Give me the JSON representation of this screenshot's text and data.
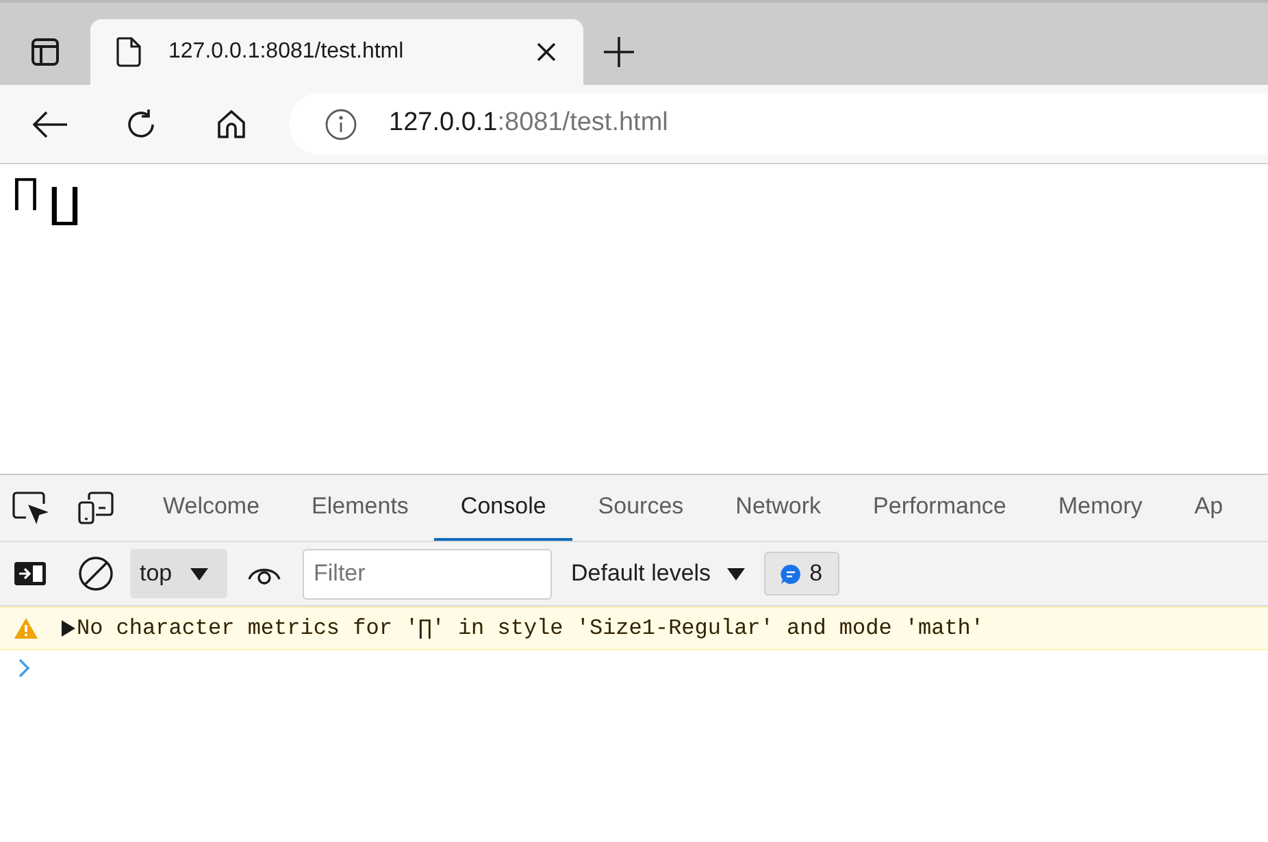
{
  "browser": {
    "tabs": [
      {
        "title": "127.0.0.1:8081/test.html",
        "selected": true
      }
    ],
    "address_bar": {
      "host": "127.0.0.1",
      "path": ":8081/test.html"
    }
  },
  "page": {
    "glyphs": [
      {
        "char": "∏",
        "kind": "inline"
      },
      {
        "char": "∐",
        "kind": "large"
      }
    ]
  },
  "devtools": {
    "tabs": [
      {
        "label": "Welcome",
        "selected": false
      },
      {
        "label": "Elements",
        "selected": false
      },
      {
        "label": "Console",
        "selected": true
      },
      {
        "label": "Sources",
        "selected": false
      },
      {
        "label": "Network",
        "selected": false
      },
      {
        "label": "Performance",
        "selected": false
      },
      {
        "label": "Memory",
        "selected": false
      },
      {
        "label": "Ap",
        "selected": false
      }
    ],
    "toolbar": {
      "context": "top",
      "filter_placeholder": "Filter",
      "levels": "Default levels",
      "message_count": "8"
    },
    "console": {
      "messages": [
        {
          "kind": "warning",
          "text": "No character metrics for '∏' in style 'Size1-Regular' and mode 'math'",
          "expanded": false
        }
      ]
    }
  }
}
